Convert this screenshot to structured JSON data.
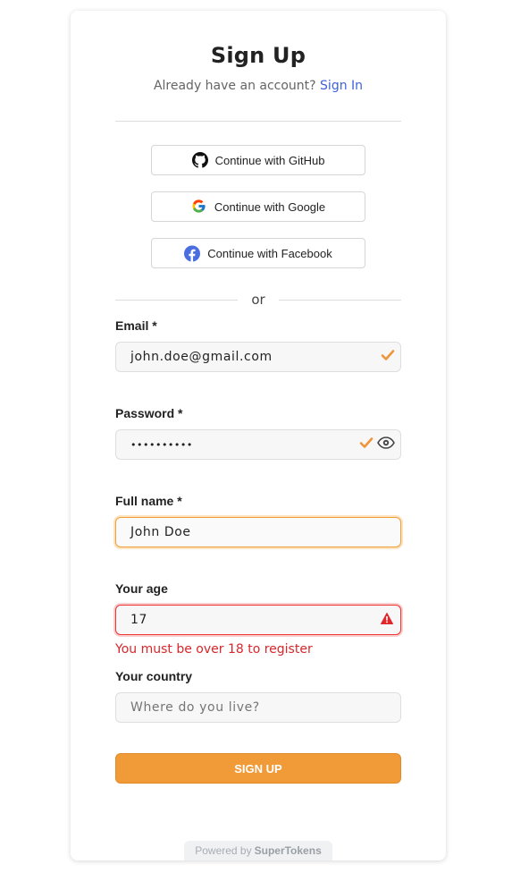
{
  "header": {
    "title": "Sign Up",
    "subtitle_text": "Already have an account?",
    "sign_in_link": "Sign In"
  },
  "social": [
    {
      "label": "Continue with GitHub",
      "icon": "github-icon"
    },
    {
      "label": "Continue with Google",
      "icon": "google-icon"
    },
    {
      "label": "Continue with Facebook",
      "icon": "facebook-icon"
    }
  ],
  "divider_text": "or",
  "form": {
    "email": {
      "label": "Email *",
      "value": "john.doe@gmail.com",
      "status": "valid"
    },
    "password": {
      "label": "Password *",
      "value": "••••••••••",
      "status": "valid"
    },
    "full_name": {
      "label": "Full name *",
      "value": "John Doe",
      "status": "focused"
    },
    "age": {
      "label": "Your age",
      "value": "17",
      "status": "error",
      "error": "You must be over 18 to register"
    },
    "country": {
      "label": "Your country",
      "value": "",
      "placeholder": "Where do you live?"
    }
  },
  "submit_label": "SIGN UP",
  "footer": {
    "powered_prefix": "Powered by",
    "brand": "SuperTokens"
  },
  "colors": {
    "accent": "#f09a38",
    "link": "#3f62d9",
    "error": "#d8272b"
  }
}
